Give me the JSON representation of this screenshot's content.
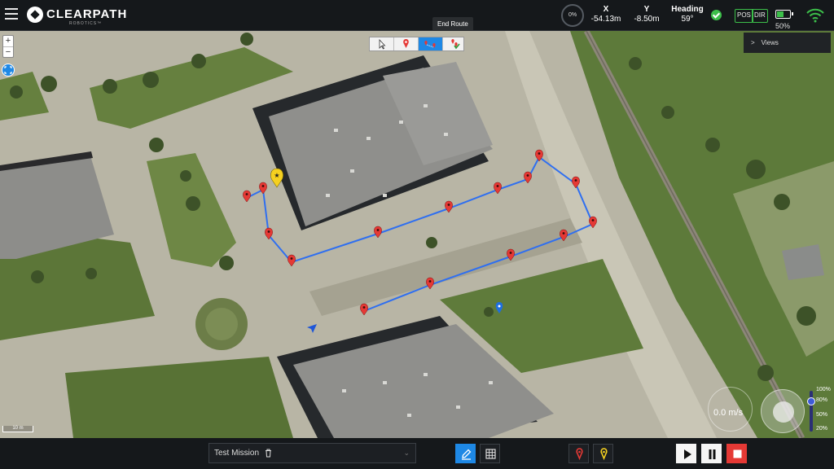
{
  "header": {
    "logo_text": "CLEARPATH",
    "logo_sub": "ROBOTICS™",
    "progress": "0%",
    "x_label": "X",
    "x_value": "-54.13m",
    "y_label": "Y",
    "y_value": "-8.50m",
    "heading_label": "Heading",
    "heading_value": "59°",
    "pos_chip": "POS",
    "dir_chip": "DIR",
    "battery_percent": 50,
    "battery_text": "50%",
    "colors": {
      "ok": "#3cbf4a",
      "bar": "#15181b"
    }
  },
  "map": {
    "zoom_in": "+",
    "zoom_out": "−",
    "tooltip": "End Route",
    "tools": [
      "select-pointer-icon",
      "place-waypoint-icon",
      "draw-route-icon",
      "end-route-icon"
    ],
    "active_tool": 2,
    "views_label": "Views",
    "scale_label": "10 m",
    "speed_label": "0.0 m/s",
    "speed_ticks": [
      "100%",
      "80%",
      "50%",
      "20%"
    ],
    "route_color": "#2f6ff0",
    "waypoint_color": "#e53935"
  },
  "footer": {
    "mission_name": "Test Mission",
    "icons": [
      "edit-icon",
      "grid-icon",
      "waypoint-red-icon",
      "waypoint-yellow-icon",
      "play-icon",
      "pause-icon",
      "stop-icon"
    ]
  }
}
